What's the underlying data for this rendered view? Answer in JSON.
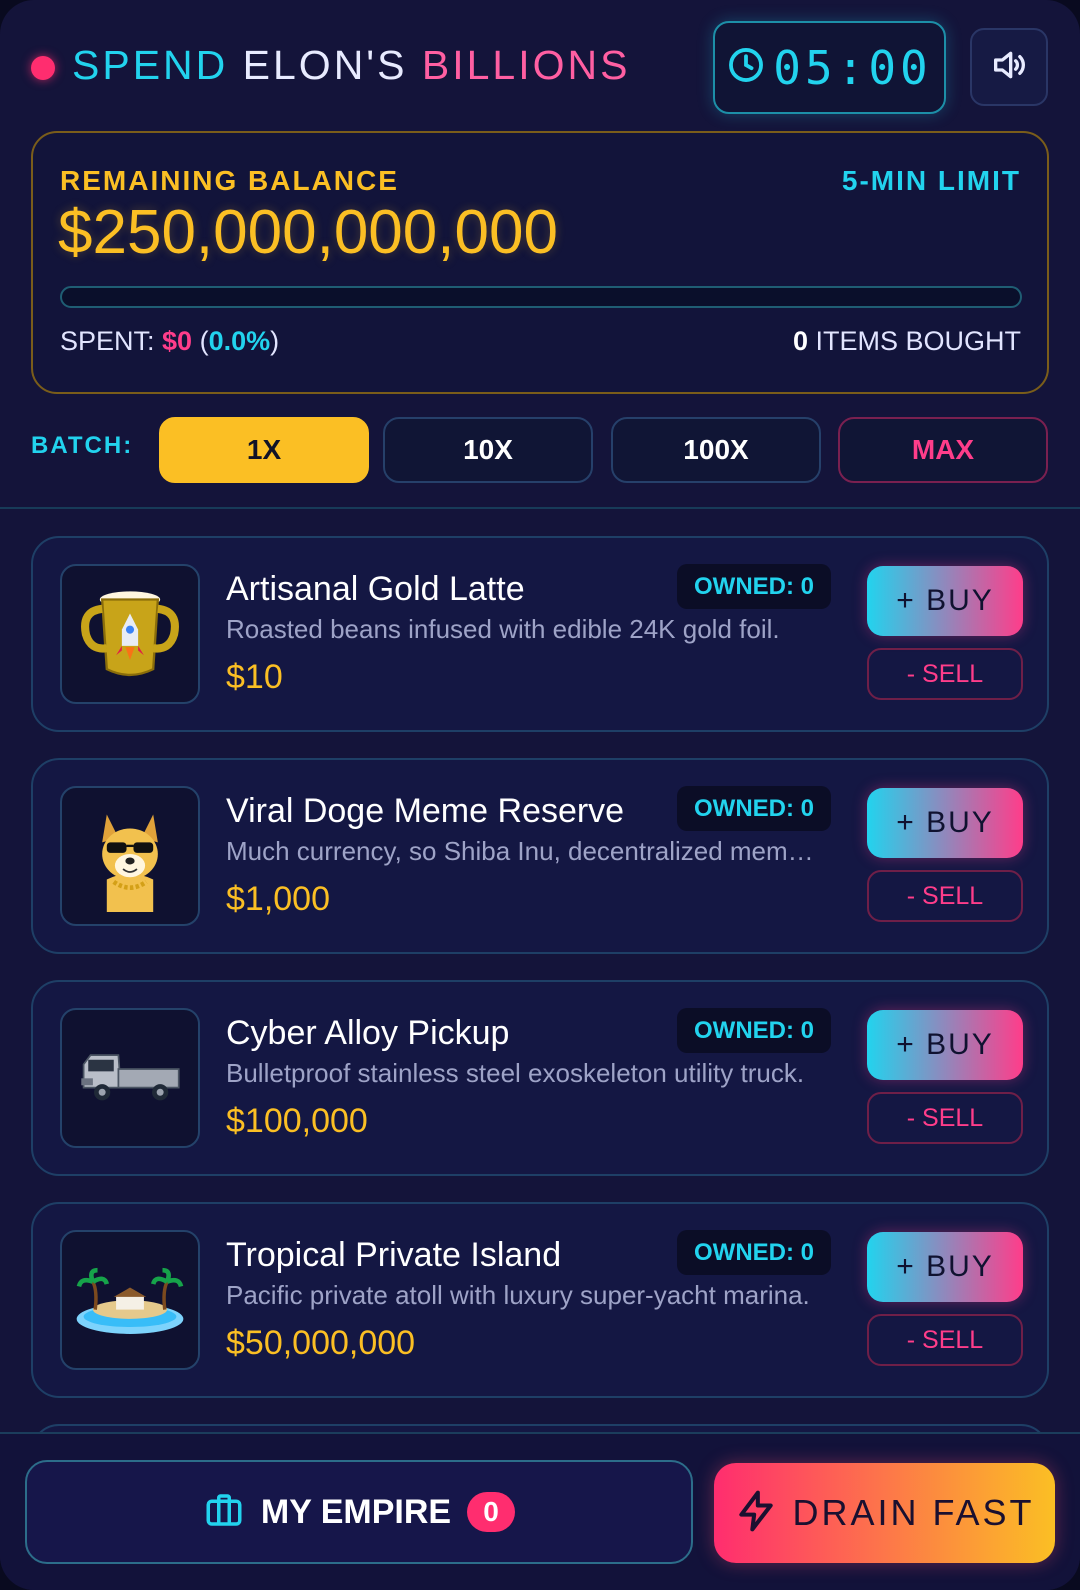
{
  "header": {
    "title_part1": "SPEND ",
    "title_part2": "ELON'S ",
    "title_part3": "BILLIONS",
    "timer": "05:00",
    "clock_icon": "clock-icon",
    "sound_icon": "speaker-volume-icon"
  },
  "balance": {
    "label": "REMAINING BALANCE",
    "limit_label": "5-MIN LIMIT",
    "amount": "$250,000,000,000",
    "progress_fraction": 0,
    "spent_prefix": "SPENT: ",
    "spent_value": "$0",
    "spent_percent": "0.0%",
    "items_count": "0",
    "items_label": " ITEMS BOUGHT"
  },
  "batch": {
    "label": "BATCH:",
    "options": [
      "1X",
      "10X",
      "100X",
      "MAX"
    ],
    "selected": "1X"
  },
  "products": [
    {
      "name": "Artisanal Gold Latte",
      "description": "Roasted beans infused with edible 24K gold foil.",
      "price": "$10",
      "owned": "OWNED: 0",
      "buy_label": "+ BUY",
      "sell_label": "- SELL",
      "icon": "gold-mug-icon"
    },
    {
      "name": "Viral Doge Meme Reserve",
      "description": "Much currency, so Shiba Inu, decentralized meme token reserve.",
      "price": "$1,000",
      "owned": "OWNED: 0",
      "buy_label": "+ BUY",
      "sell_label": "- SELL",
      "icon": "shiba-doge-icon"
    },
    {
      "name": "Cyber Alloy Pickup",
      "description": "Bulletproof stainless steel exoskeleton utility truck.",
      "price": "$100,000",
      "owned": "OWNED: 0",
      "buy_label": "+ BUY",
      "sell_label": "- SELL",
      "icon": "pickup-truck-icon"
    },
    {
      "name": "Tropical Private Island",
      "description": "Pacific private atoll with luxury super-yacht marina.",
      "price": "$50,000,000",
      "owned": "OWNED: 0",
      "buy_label": "+ BUY",
      "sell_label": "- SELL",
      "icon": "island-icon"
    }
  ],
  "bottom_bar": {
    "empire_label": "MY EMPIRE",
    "empire_count": "0",
    "empire_icon": "briefcase-icon",
    "drain_label": "DRAIN FAST",
    "drain_icon": "lightning-icon"
  },
  "colors": {
    "background": "#14143a",
    "cyan": "#22d3ee",
    "pink": "#ff3d8a",
    "gold": "#fbbf24"
  }
}
